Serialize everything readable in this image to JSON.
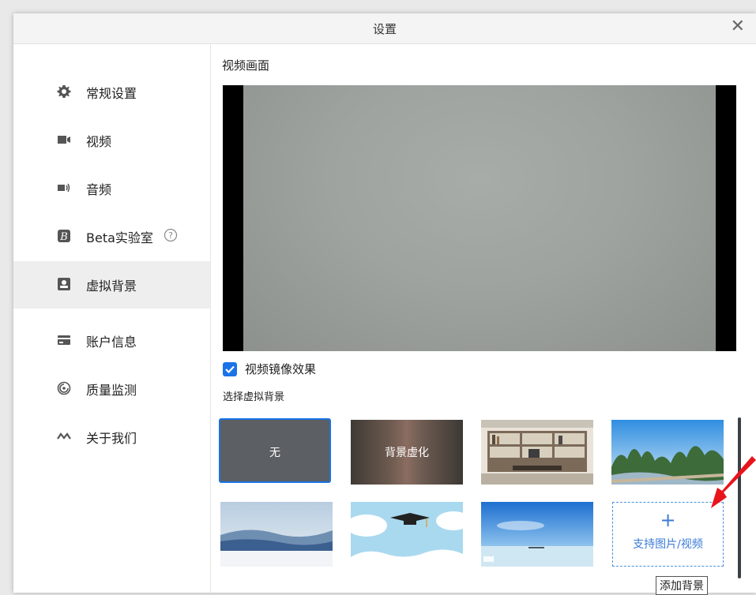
{
  "dialog": {
    "title": "设置"
  },
  "sidebar": {
    "items": [
      {
        "label": "常规设置",
        "icon": "gear-icon"
      },
      {
        "label": "视频",
        "icon": "video-camera-icon"
      },
      {
        "label": "音频",
        "icon": "speaker-icon"
      },
      {
        "label": "Beta实验室",
        "icon": "beta-icon"
      },
      {
        "label": "虚拟背景",
        "icon": "portrait-icon",
        "active": true
      },
      {
        "label": "账户信息",
        "icon": "card-icon"
      },
      {
        "label": "质量监测",
        "icon": "gauge-icon"
      },
      {
        "label": "关于我们",
        "icon": "logo-icon"
      }
    ]
  },
  "main": {
    "section_title": "视频画面",
    "mirror_label": "视频镜像效果",
    "mirror_checked": true,
    "choose_label": "选择虚拟背景",
    "backgrounds": [
      {
        "label": "无",
        "selected": true
      },
      {
        "label": "背景虚化"
      },
      {
        "name": "bookshelf-office"
      },
      {
        "name": "karst-river"
      },
      {
        "name": "sea-of-clouds"
      },
      {
        "name": "graduation-cap"
      },
      {
        "name": "ocean-horizon"
      }
    ],
    "add_button": {
      "plus": "+",
      "label": "支持图片/视频"
    },
    "tooltip": "添加背景"
  },
  "colors": {
    "accent": "#1a73e8",
    "annotation_arrow": "#e8141c"
  }
}
